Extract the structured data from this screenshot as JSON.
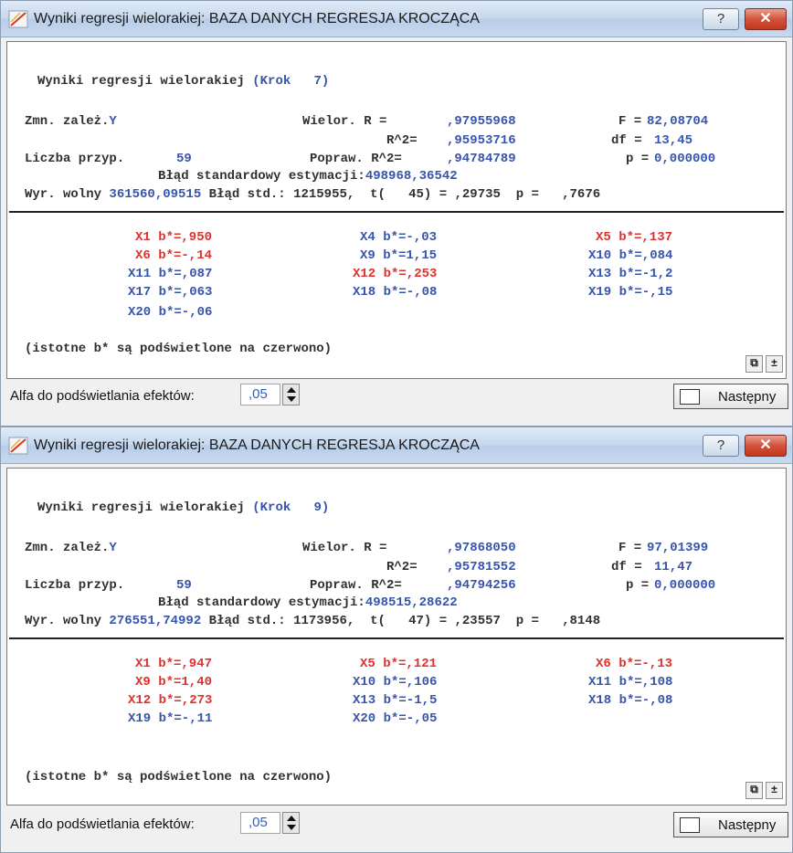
{
  "windows": [
    {
      "title": "Wyniki regresji wielorakiej: BAZA DANYCH REGRESJA KROCZĄCA",
      "help_glyph": "?",
      "close_glyph": "✕",
      "heading_text": "Wyniki regresji wielorakiej ",
      "heading_step": "(Krok   7)",
      "dep_label": "Zmn. zależ.",
      "dep_var": "Y",
      "multR_label": "Wielor. R =",
      "multR_value": ",97955968",
      "F_label": "F =",
      "F_value": "82,08704",
      "r2_label": "R^2=",
      "r2_value": ",95953716",
      "df_label": "df =",
      "df_value": "13,45",
      "n_label": "Liczba przyp.",
      "n_value": "59",
      "adjR2_label": "Popraw. R^2=",
      "adjR2_value": ",94784789",
      "p_label": "p =",
      "p_value": "0,000000",
      "se_label": "Błąd standardowy estymacji:",
      "se_value": "498968,36542",
      "int_label": "Wyr. wolny",
      "int_value": "361560,09515",
      "int_rest": "Błąd std.: 1215955,  t(   45) = ,29735  p =   ,7676",
      "coefficients": [
        {
          "text": "X1 b*=,950",
          "sig": true
        },
        {
          "text": "X4 b*=-,03",
          "sig": false
        },
        {
          "text": "X5 b*=,137",
          "sig": true
        },
        {
          "text": "X6 b*=-,14",
          "sig": true
        },
        {
          "text": "X9 b*=1,15",
          "sig": false
        },
        {
          "text": "X10 b*=,084",
          "sig": false
        },
        {
          "text": "X11 b*=,087",
          "sig": false
        },
        {
          "text": "X12 b*=,253",
          "sig": true
        },
        {
          "text": "X13 b*=-1,2",
          "sig": false
        },
        {
          "text": "X17 b*=,063",
          "sig": false
        },
        {
          "text": "X18 b*=-,08",
          "sig": false
        },
        {
          "text": "X19 b*=-,15",
          "sig": false
        },
        {
          "text": "X20 b*=-,06",
          "sig": false
        }
      ],
      "note": "(istotne b* są podświetlone na czerwono)",
      "alpha_label": "Alfa do podświetlania efektów:",
      "alpha_value": ",05",
      "next_label": "Następny"
    },
    {
      "title": "Wyniki regresji wielorakiej: BAZA DANYCH REGRESJA KROCZĄCA",
      "help_glyph": "?",
      "close_glyph": "✕",
      "heading_text": "Wyniki regresji wielorakiej ",
      "heading_step": "(Krok   9)",
      "dep_label": "Zmn. zależ.",
      "dep_var": "Y",
      "multR_label": "Wielor. R =",
      "multR_value": ",97868050",
      "F_label": "F =",
      "F_value": "97,01399",
      "r2_label": "R^2=",
      "r2_value": ",95781552",
      "df_label": "df =",
      "df_value": "11,47",
      "n_label": "Liczba przyp.",
      "n_value": "59",
      "adjR2_label": "Popraw. R^2=",
      "adjR2_value": ",94794256",
      "p_label": "p =",
      "p_value": "0,000000",
      "se_label": "Błąd standardowy estymacji:",
      "se_value": "498515,28622",
      "int_label": "Wyr. wolny",
      "int_value": "276551,74992",
      "int_rest": "Błąd std.: 1173956,  t(   47) = ,23557  p =   ,8148",
      "coefficients": [
        {
          "text": "X1 b*=,947",
          "sig": true
        },
        {
          "text": "X5 b*=,121",
          "sig": true
        },
        {
          "text": "X6 b*=-,13",
          "sig": true
        },
        {
          "text": "X9 b*=1,40",
          "sig": true
        },
        {
          "text": "X10 b*=,106",
          "sig": false
        },
        {
          "text": "X11 b*=,108",
          "sig": false
        },
        {
          "text": "X12 b*=,273",
          "sig": true
        },
        {
          "text": "X13 b*=-1,5",
          "sig": false
        },
        {
          "text": "X18 b*=-,08",
          "sig": false
        },
        {
          "text": "X19 b*=-,11",
          "sig": false
        },
        {
          "text": "X20 b*=-,05",
          "sig": false
        }
      ],
      "note": "(istotne b* są podświetlone na czerwono)",
      "alpha_label": "Alfa do podświetlania efektów:",
      "alpha_value": ",05",
      "next_label": "Następny"
    }
  ],
  "colors": {
    "significant": "#e0302c",
    "value": "#3754ad",
    "label": "#303030"
  },
  "icons": {
    "app": "statistica-window-icon",
    "copy": "copy-icon",
    "expand": "expand-icon",
    "next": "results-sheet-icon"
  }
}
